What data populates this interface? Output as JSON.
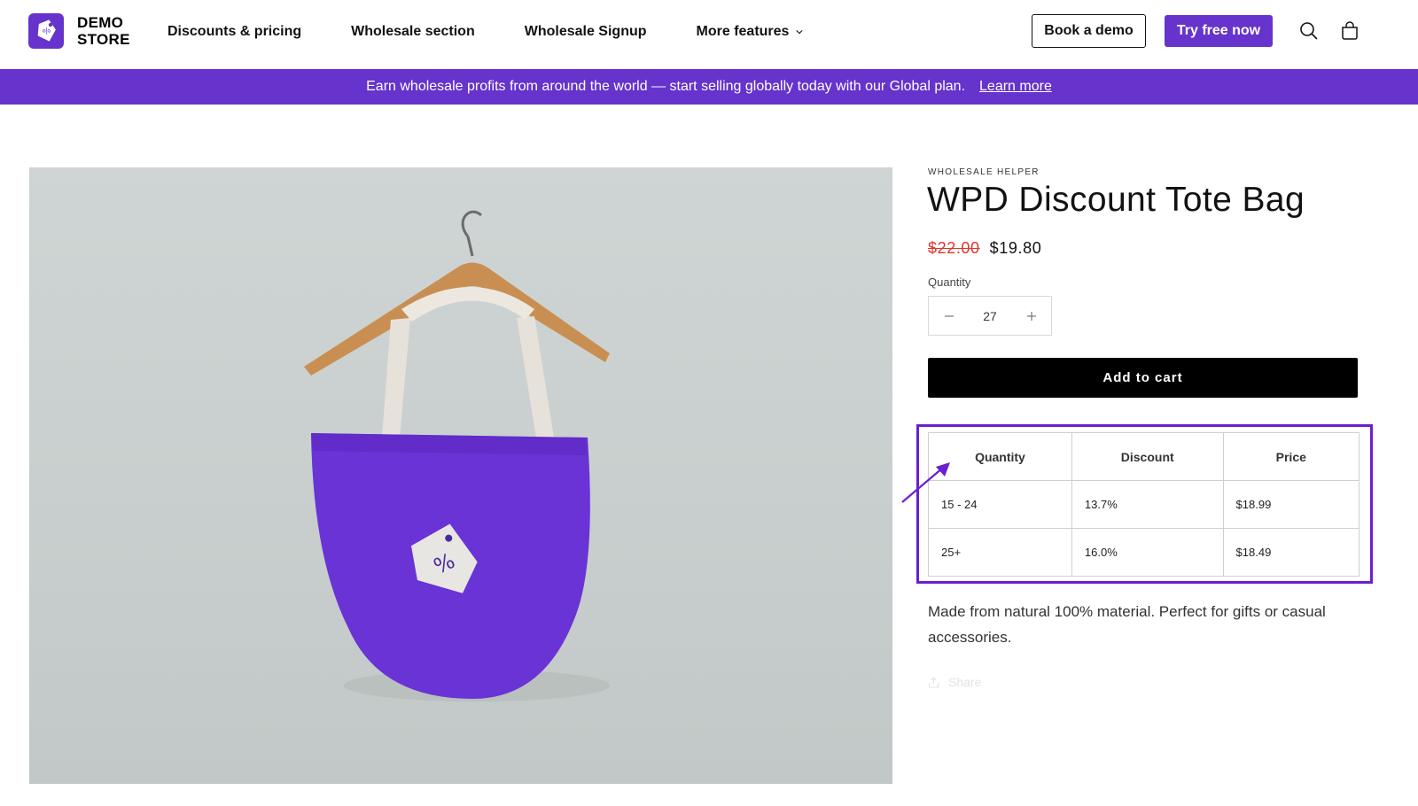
{
  "header": {
    "logo_line1": "DEMO",
    "logo_line2": "STORE",
    "nav": [
      {
        "label": "Discounts & pricing"
      },
      {
        "label": "Wholesale section"
      },
      {
        "label": "Wholesale Signup"
      },
      {
        "label": "More features"
      }
    ],
    "book_demo": "Book a demo",
    "try_free": "Try free now",
    "icons": [
      "search-icon",
      "cart-icon"
    ]
  },
  "banner": {
    "text": "Earn wholesale profits from around the world — start selling globally today with our Global plan.",
    "link": "Learn more"
  },
  "product": {
    "vendor": "WHOLESALE HELPER",
    "title": "WPD Discount Tote Bag",
    "price_original": "$22.00",
    "price_sale": "$19.80",
    "quantity_label": "Quantity",
    "quantity_value": "27",
    "add_to_cart": "Add to cart",
    "description": "Made from natural 100% material. Perfect for gifts or casual accessories.",
    "share": "Share"
  },
  "discount_table": {
    "headers": [
      "Quantity",
      "Discount",
      "Price"
    ],
    "rows": [
      [
        "15 - 24",
        "13.7%",
        "$18.99"
      ],
      [
        "25+",
        "16.0%",
        "$18.49"
      ]
    ]
  },
  "colors": {
    "brand": "#6633cc",
    "sale": "#e0352b",
    "highlight": "#6a1fd0"
  }
}
